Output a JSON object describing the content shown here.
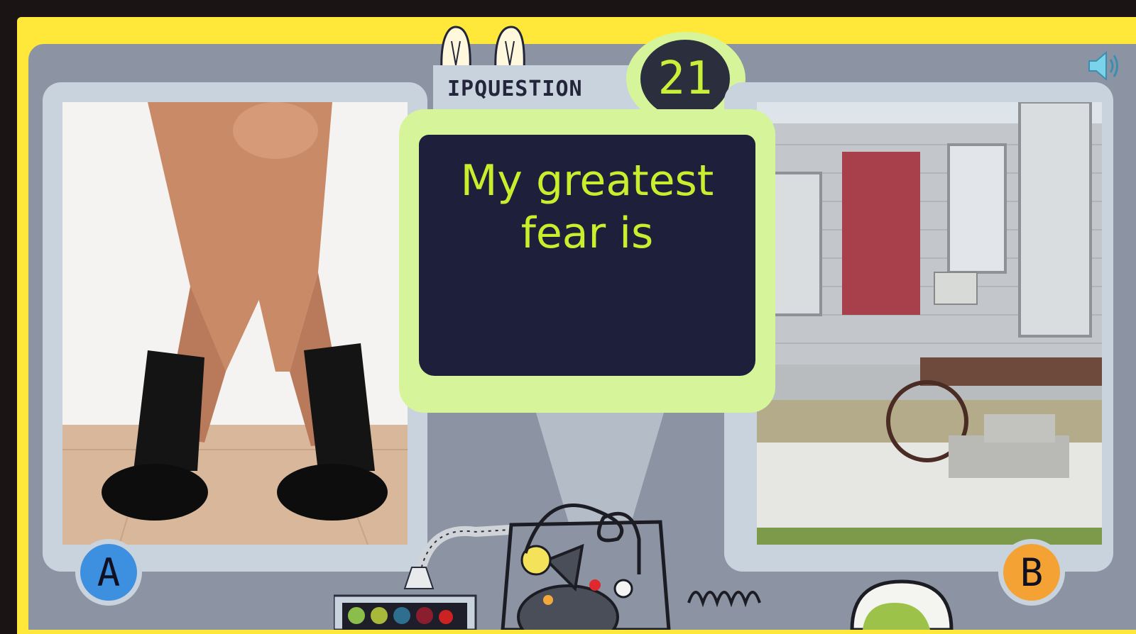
{
  "header": {
    "question_label": "IPQUESTION",
    "question_number": "21"
  },
  "question": {
    "line1": "My greatest",
    "line2": "fear is"
  },
  "options": [
    {
      "badge": "A",
      "badge_color": "#3d8fe0",
      "image_icon": "legs-photo"
    },
    {
      "badge": "B",
      "badge_color": "#f5a235",
      "image_icon": "trailer-photo"
    }
  ],
  "controls": {
    "sound_icon": "speaker-icon"
  },
  "colors": {
    "frame": "#ffe83a",
    "stage": "#8c94a3",
    "screen": "#1d1f3b",
    "screen_border": "#d6f59a",
    "question_text": "#c8ee2e"
  }
}
